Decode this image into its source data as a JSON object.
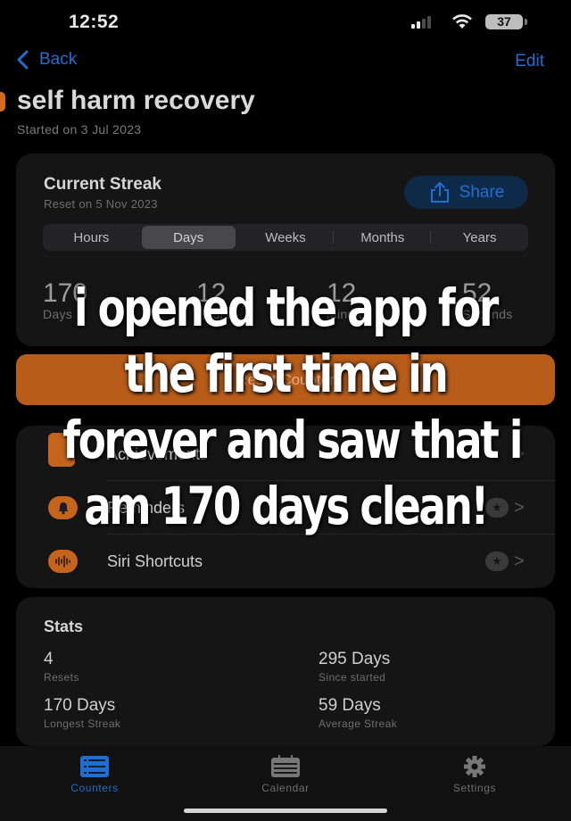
{
  "status_bar": {
    "time": "12:52",
    "battery": "37",
    "icons": [
      "signal-icon",
      "wifi-icon",
      "battery-icon"
    ]
  },
  "nav": {
    "back_label": "Back",
    "edit_label": "Edit"
  },
  "counter": {
    "title": "self harm recovery",
    "started": "Started on 3 Jul 2023",
    "accent": "#d36a1e"
  },
  "streak": {
    "heading": "Current Streak",
    "reset_on": "Reset on 5 Nov 2023",
    "share_label": "Share",
    "units": [
      {
        "label": "Hours",
        "active": false
      },
      {
        "label": "Days",
        "active": true
      },
      {
        "label": "Weeks",
        "active": false
      },
      {
        "label": "Months",
        "active": false
      },
      {
        "label": "Years",
        "active": false
      }
    ],
    "counts": [
      {
        "value": "170",
        "label": "Days"
      },
      {
        "value": "12",
        "label": "Hours"
      },
      {
        "value": "12",
        "label": "Minutes"
      },
      {
        "value": "52",
        "label": "Seconds"
      }
    ]
  },
  "reset_button": {
    "label": "Reset Counter",
    "color": "#b85c1a"
  },
  "settings_list": [
    {
      "label": "Achievements",
      "icon": "trophy-icon",
      "has_star": false
    },
    {
      "label": "Reminders",
      "icon": "bell-icon",
      "has_star": true
    },
    {
      "label": "Siri Shortcuts",
      "icon": "waveform-icon",
      "has_star": true
    }
  ],
  "stats": {
    "heading": "Stats",
    "items": [
      {
        "value": "4",
        "label": "Resets"
      },
      {
        "value": "295 Days",
        "label": "Since started"
      },
      {
        "value": "170 Days",
        "label": "Longest Streak"
      },
      {
        "value": "59 Days",
        "label": "Average Streak"
      }
    ]
  },
  "tab_bar": {
    "tabs": [
      {
        "label": "Counters",
        "icon": "list-icon",
        "active": true
      },
      {
        "label": "Calendar",
        "icon": "calendar-icon",
        "active": false
      },
      {
        "label": "Settings",
        "icon": "gear-icon",
        "active": false
      }
    ],
    "active_color": "#1f6fd1",
    "inactive_color": "#6f6f6f"
  },
  "caption": {
    "lines": [
      "i opened the app for",
      "the first time in",
      "forever and saw that i",
      "am 170 days clean!"
    ]
  }
}
